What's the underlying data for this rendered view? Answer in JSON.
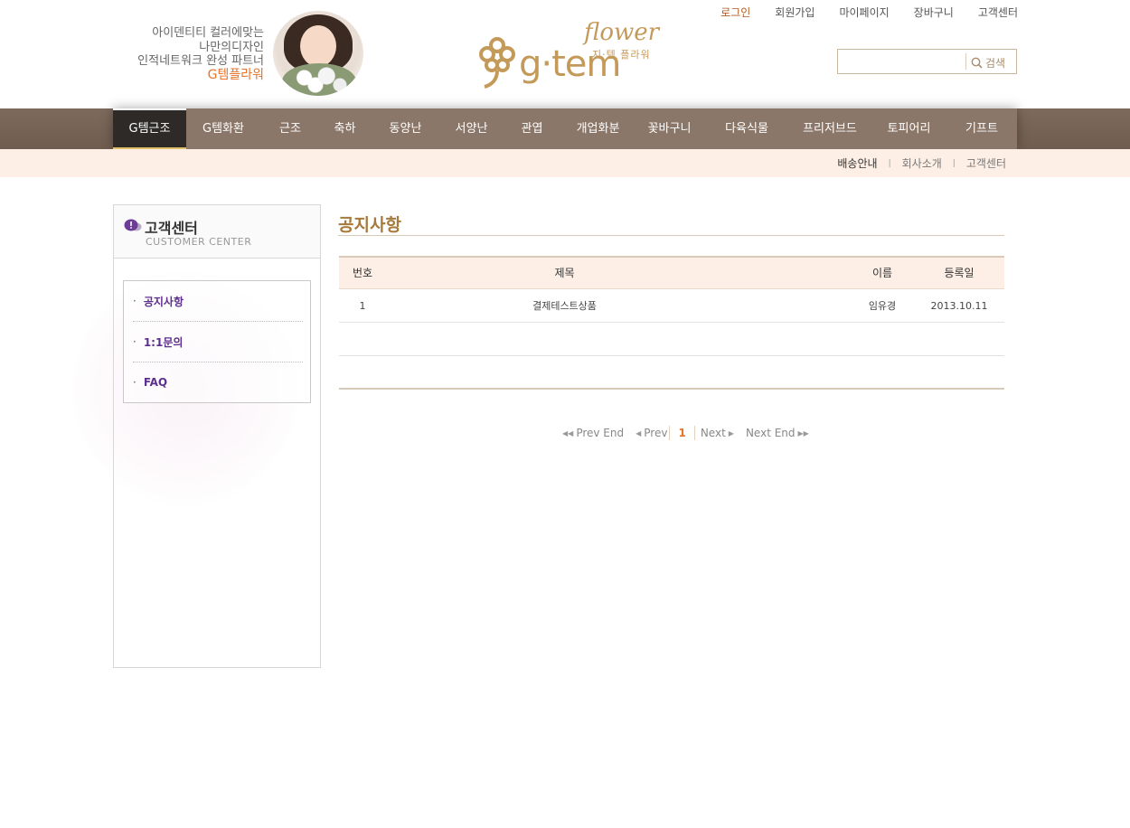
{
  "header": {
    "slogan_lines": [
      "아이덴티티 컬러에맞는",
      "나만의디자인",
      "인적네트워크 완성 파트너"
    ],
    "slogan_brand": "G템플라워",
    "logo": {
      "main": "g·tem",
      "script": "flower",
      "sub": "지·템 플라워"
    },
    "top_links": [
      "로그인",
      "회원가입",
      "마이페이지",
      "장바구니",
      "고객센터"
    ],
    "search": {
      "value": "",
      "button_label": "검색"
    }
  },
  "main_nav": {
    "items": [
      "G템근조",
      "G템화환",
      "근조",
      "축하",
      "동양난",
      "서양난",
      "관엽",
      "개업화분",
      "꽃바구니",
      "다육식물",
      "프리저브드",
      "토피어리",
      "기프트"
    ],
    "active_index": 0
  },
  "sub_nav": [
    "배송안내",
    "회사소개",
    "고객센터"
  ],
  "sidebar": {
    "title": "고객센터",
    "title_en": "CUSTOMER CENTER",
    "items": [
      "공지사항",
      "1:1문의",
      "FAQ"
    ],
    "bullet": "·"
  },
  "content": {
    "page_title": "공지사항",
    "table": {
      "headers": {
        "no": "번호",
        "title": "제목",
        "name": "이름",
        "date": "등록일"
      },
      "rows": [
        {
          "no": "1",
          "title": "결제테스트상품",
          "name": "임유경",
          "date": "2013.10.11"
        }
      ]
    },
    "pagination": {
      "prev_end": "Prev End",
      "prev": "Prev",
      "current": "1",
      "next": "Next",
      "next_end": "Next End"
    }
  },
  "colors": {
    "brand_gold": "#c49a5a",
    "accent_orange": "#e8732b",
    "nav_brown": "#8b7769",
    "sub_bar": "#fdefe5",
    "sidebar_link": "#5e2f8f"
  }
}
